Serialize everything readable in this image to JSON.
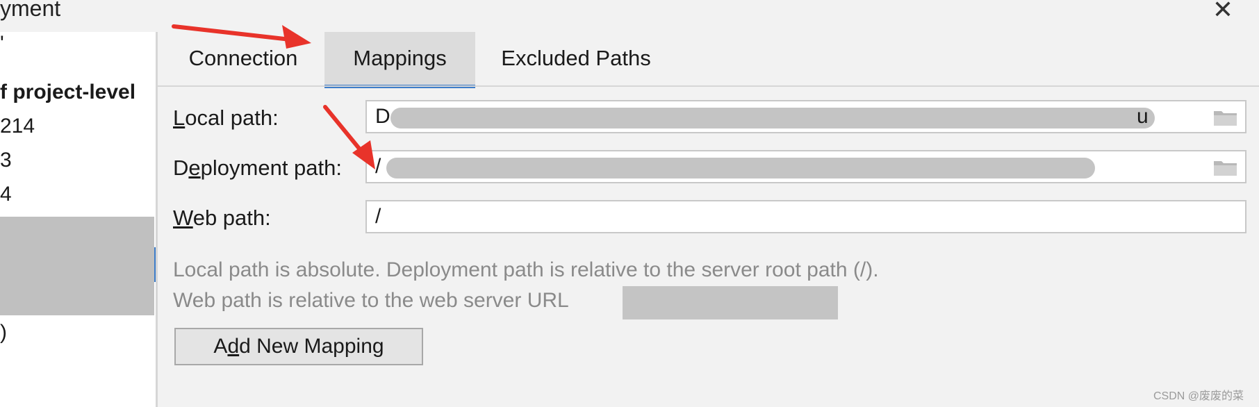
{
  "window": {
    "title_fragment": "yment",
    "close_glyph": "✕"
  },
  "sidebar": {
    "items": [
      {
        "label": "'"
      },
      {
        "label": "f project-level"
      },
      {
        "label": "214"
      },
      {
        "label": "3"
      },
      {
        "label": "4"
      },
      {
        "label": ")"
      }
    ]
  },
  "tabs": [
    {
      "label": "Connection",
      "active": false
    },
    {
      "label": "Mappings",
      "active": true
    },
    {
      "label": "Excluded Paths",
      "active": false
    }
  ],
  "form": {
    "local_path": {
      "label_prefix": "",
      "label_mnemonic": "L",
      "label_rest": "ocal path:",
      "value_start": "D",
      "value_end": "u"
    },
    "deployment_path": {
      "label_prefix": "D",
      "label_mnemonic": "e",
      "label_rest": "ployment path:",
      "value_start": "/"
    },
    "web_path": {
      "label_prefix": "",
      "label_mnemonic": "W",
      "label_rest": "eb path:",
      "value": "/"
    }
  },
  "help": {
    "line1": "Local path is absolute. Deployment path is relative to the server root path (/).",
    "line2": "Web path is relative to the web server URL"
  },
  "actions": {
    "add_prefix": "A",
    "add_mnemonic": "d",
    "add_rest": "d New Mapping"
  },
  "watermark": "CSDN @废废的菜",
  "colors": {
    "accent": "#3d7dca",
    "annotation_arrow": "#e8332a",
    "redaction": "#c4c4c4"
  },
  "icons": {
    "folder": "folder-icon",
    "close": "close-icon"
  }
}
